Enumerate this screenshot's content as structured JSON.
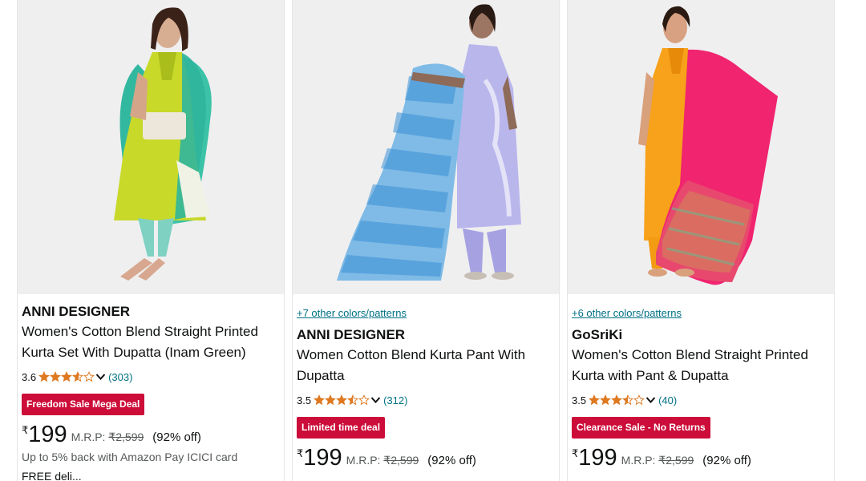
{
  "products": [
    {
      "colors_link": "",
      "brand": "ANNI DESIGNER",
      "title": "Women's Cotton Blend Straight Printed Kurta Set With Dupatta (Inam Green)",
      "rating": "3.6",
      "rating_value": 3.6,
      "review_count": "(303)",
      "badge": "Freedom Sale Mega Deal",
      "currency": "₹",
      "price": "199",
      "mrp_label": "M.R.P:",
      "mrp": "₹2,599",
      "discount": "(92% off)",
      "cashback": "Up to 5% back with Amazon Pay ICICI card",
      "delivery": "FREE deli..."
    },
    {
      "colors_link": "+7 other colors/patterns",
      "brand": "ANNI DESIGNER",
      "title": "Women Cotton Blend Kurta Pant With Dupatta",
      "rating": "3.5",
      "rating_value": 3.5,
      "review_count": "(312)",
      "badge": "Limited time deal",
      "currency": "₹",
      "price": "199",
      "mrp_label": "M.R.P:",
      "mrp": "₹2,599",
      "discount": "(92% off)"
    },
    {
      "colors_link": "+6 other colors/patterns",
      "brand": "GoSriKi",
      "title": "Women's Cotton Blend Straight Printed Kurta with Pant & Dupatta",
      "rating": "3.5",
      "rating_value": 3.5,
      "review_count": "(40)",
      "badge": "Clearance Sale - No Returns",
      "currency": "₹",
      "price": "199",
      "mrp_label": "M.R.P:",
      "mrp": "₹2,599",
      "discount": "(92% off)"
    }
  ],
  "colors": {
    "link": "#007185",
    "badge": "#cc0c39",
    "star": "#de7921",
    "image_bg": "#efeff0",
    "muted": "#565959"
  }
}
